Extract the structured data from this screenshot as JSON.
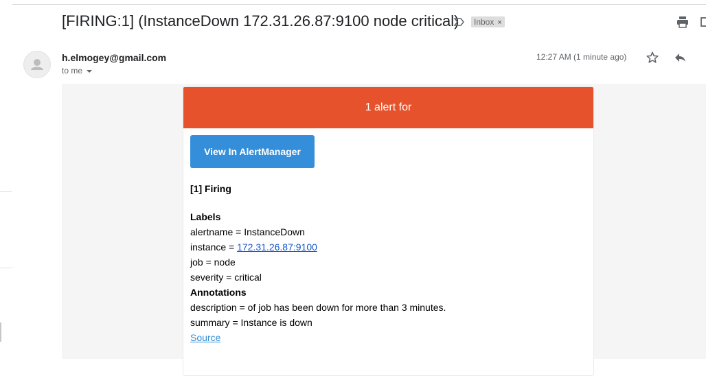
{
  "header": {
    "subject": "[FIRING:1] (InstanceDown 172.31.26.87:9100 node critical)",
    "label": "Inbox",
    "label_remove": "×",
    "icons": [
      "important-icon",
      "print-icon",
      "new-window-icon"
    ]
  },
  "message": {
    "sender": "h.elmogey@gmail.com",
    "recipient": "to me",
    "time": "12:27 AM (1 minute ago)",
    "icons": [
      "avatar-icon",
      "star-icon",
      "reply-icon"
    ]
  },
  "alert": {
    "header": "1 alert for",
    "header_color": "#e6522c",
    "button_label": "View In AlertManager",
    "button_color": "#348eda",
    "firing": "[1] Firing",
    "labels_title": "Labels",
    "alertname": {
      "key": "alertname = ",
      "value": "InstanceDown"
    },
    "instance": {
      "key": "instance = ",
      "value": "172.31.26.87:9100"
    },
    "job": {
      "key": "job = ",
      "value": "node"
    },
    "severity": {
      "key": "severity = ",
      "value": "critical"
    },
    "annotations_title": "Annotations",
    "description": {
      "key": "description = ",
      "value": "of job has been down for more than 3 minutes."
    },
    "summary": {
      "key": "summary = ",
      "value": "Instance is down"
    },
    "source": "Source"
  }
}
